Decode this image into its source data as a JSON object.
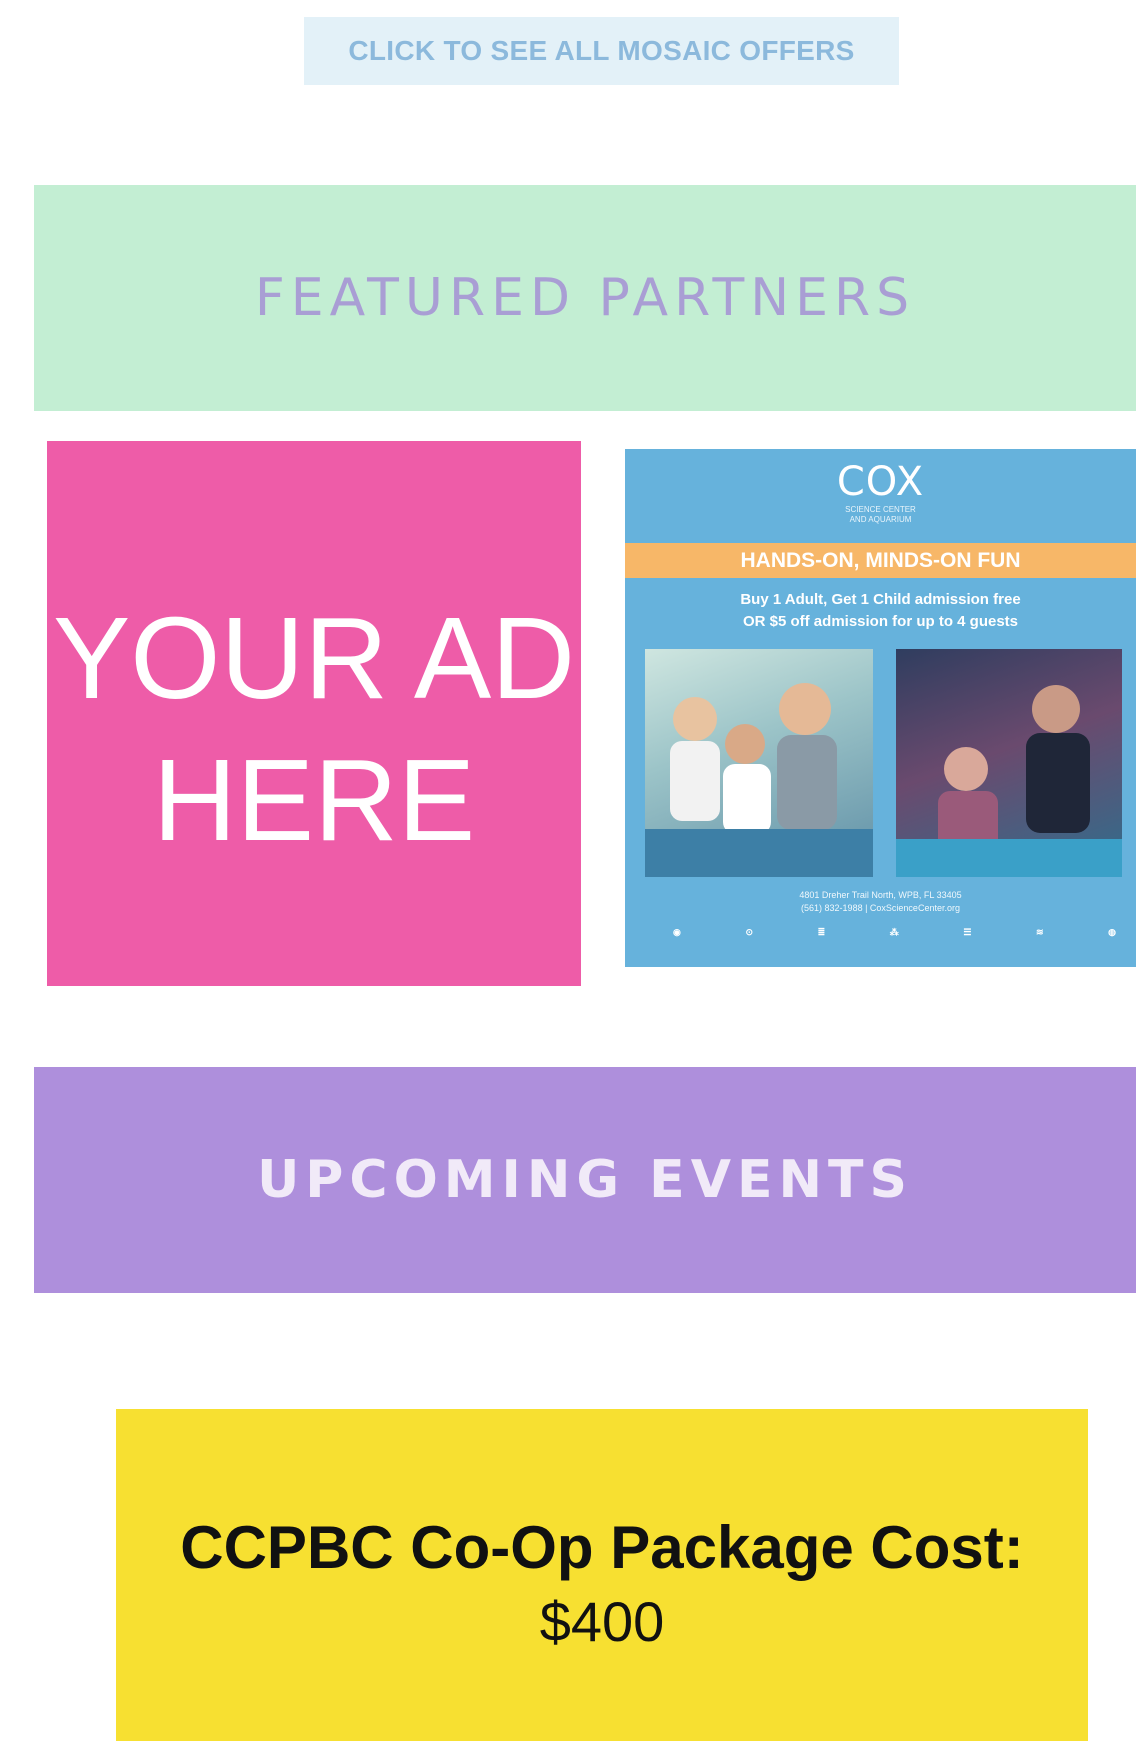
{
  "offers_link": {
    "label": "CLICK TO SEE ALL MOSAIC OFFERS"
  },
  "featured_banner": {
    "title": "FEATURED PARTNERS"
  },
  "ad_placeholder": {
    "line1": "YOUR AD",
    "line2": "HERE"
  },
  "cox_ad": {
    "logo": "COX",
    "logo_sub1": "SCIENCE CENTER",
    "logo_sub2": "AND AQUARIUM",
    "tagline": "HANDS-ON, MINDS-ON FUN",
    "offer_line1": "Buy 1 Adult, Get 1 Child admission free",
    "offer_line2": "OR $5 off admission for up to 4 guests",
    "address_line1": "4801 Dreher Trail North, WPB, FL 33405",
    "address_line2": "(561) 832-1988 | CoxScienceCenter.org",
    "sponsors": [
      "◉",
      "⊙",
      "≣",
      "⁂",
      "☰",
      "≋",
      "◍"
    ]
  },
  "events_banner": {
    "title": "UPCOMING EVENTS"
  },
  "package": {
    "label": "CCPBC Co-Op Package Cost:",
    "value": "$400"
  },
  "colors": {
    "featured_bg": "#c3eed3",
    "events_bg": "#ae8fdc",
    "ad_pink": "#ee5ca8",
    "cost_yellow": "#f7e031",
    "cox_blue": "#66b2dc",
    "cox_orange": "#f7b768"
  }
}
